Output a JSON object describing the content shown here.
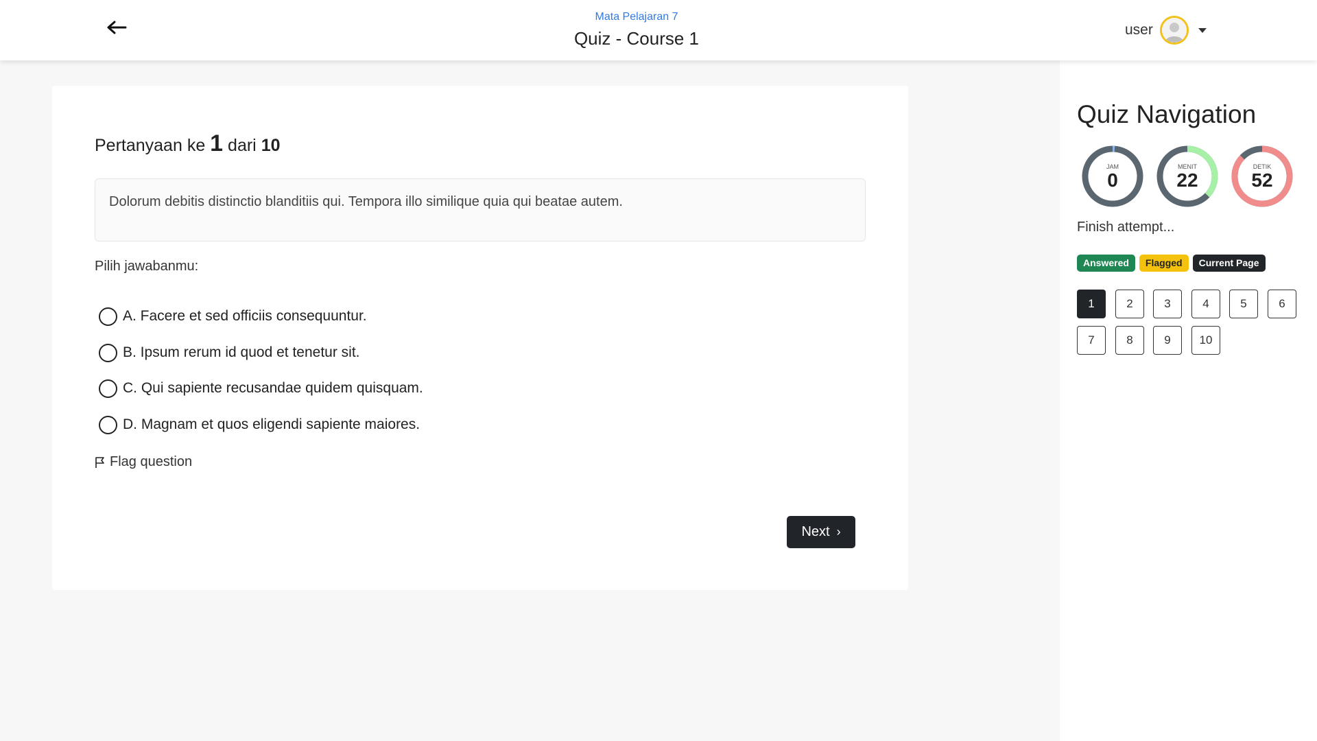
{
  "header": {
    "subject": "Mata Pelajaran 7",
    "title": "Quiz - Course 1",
    "user_name": "user",
    "icons": {
      "back": "arrow-left-icon",
      "avatar": "user-avatar-icon",
      "menu": "caret-down-icon"
    }
  },
  "question": {
    "heading_prefix": "Pertanyaan ke",
    "current": "1",
    "heading_middle": "dari",
    "total": "10",
    "text": "Dolorum debitis distinctio blanditiis qui. Tempora illo similique quia qui beatae autem.",
    "choose_label": "Pilih jawabanmu:",
    "options": [
      "A. Facere et sed officiis consequuntur.",
      "B. Ipsum rerum id quod et tenetur sit.",
      "C. Qui sapiente recusandae quidem quisquam.",
      "D. Magnam et quos eligendi sapiente maiores."
    ],
    "selected_option": null,
    "flag_label": "Flag question",
    "next_label": "Next"
  },
  "navigation": {
    "title": "Quiz Navigation",
    "timer": [
      {
        "label": "JAM",
        "value": "0",
        "fraction": 0.0,
        "color": "#8fb5e8"
      },
      {
        "label": "MENIT",
        "value": "22",
        "fraction": 0.37,
        "color": "#a8f0a8"
      },
      {
        "label": "DETIK",
        "value": "52",
        "fraction": 0.87,
        "color": "#f08c8c"
      }
    ],
    "finish_label": "Finish attempt...",
    "legend": {
      "answered": "Answered",
      "flagged": "Flagged",
      "current": "Current Page"
    },
    "questions": [
      "1",
      "2",
      "3",
      "4",
      "5",
      "6",
      "7",
      "8",
      "9",
      "10"
    ],
    "current_page": "1"
  },
  "colors": {
    "accent": "#2f7ae5",
    "dark": "#212529",
    "answered": "#1e8753",
    "flagged": "#f4c20d",
    "avatar_ring": "#f2c21b"
  }
}
